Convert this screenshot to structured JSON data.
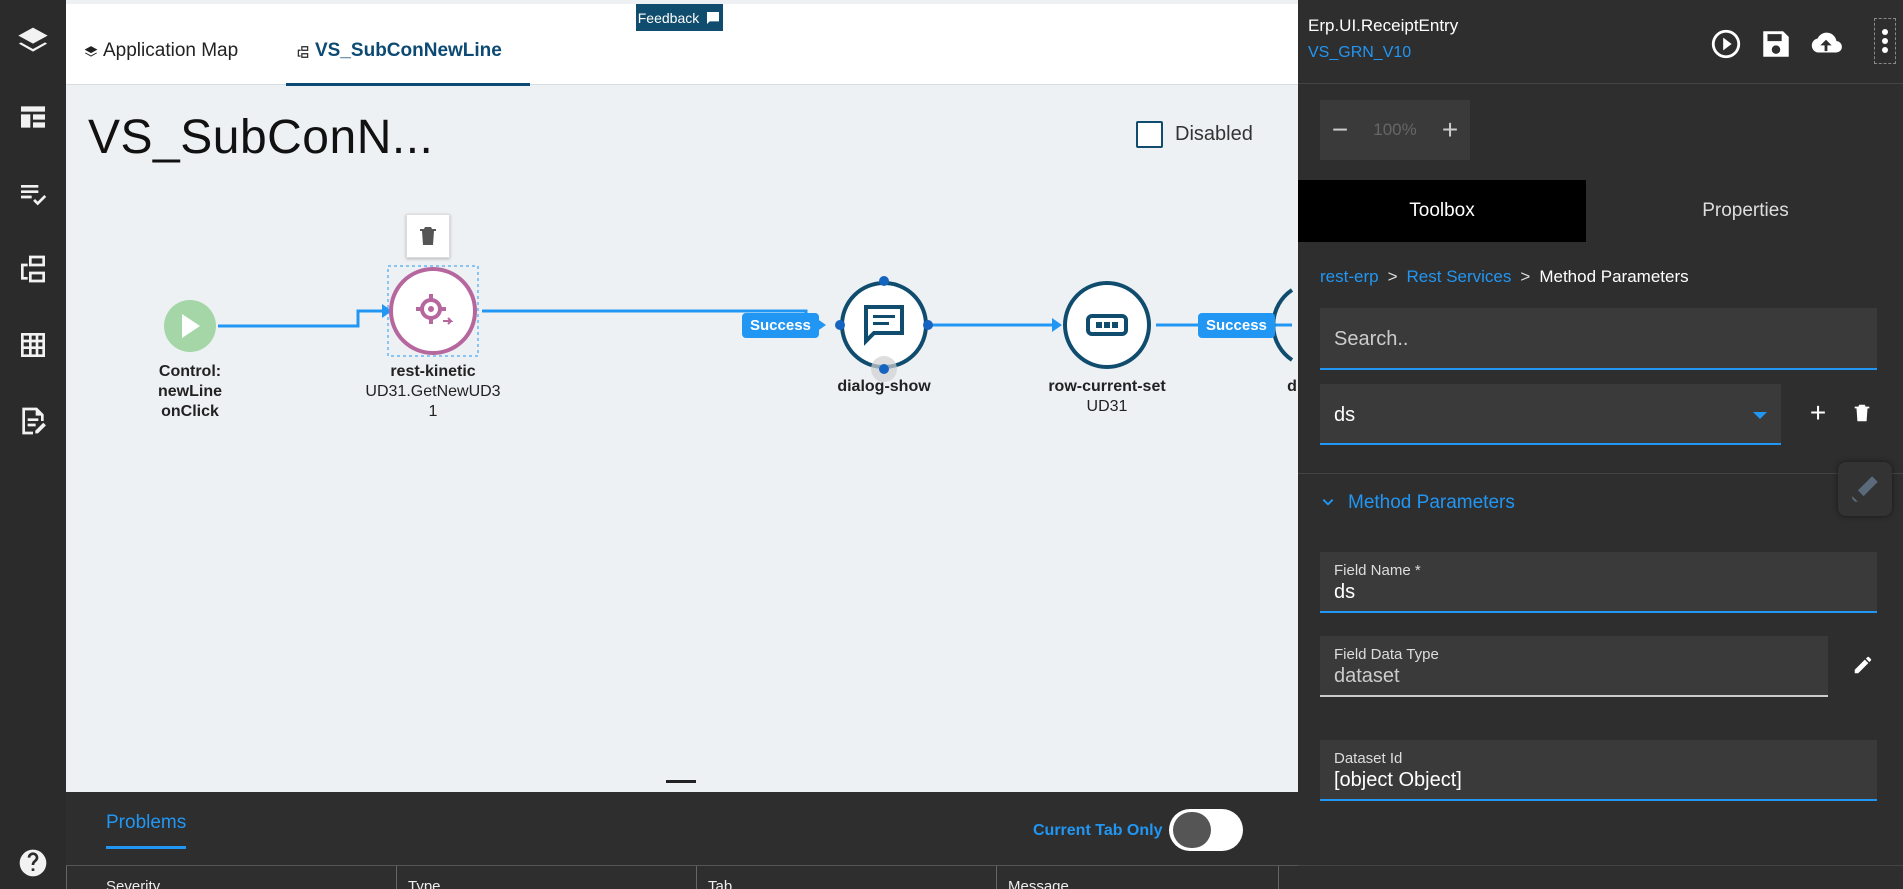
{
  "rail": {
    "icons": [
      "layers-icon",
      "layout-icon",
      "checklist-icon",
      "flow-icon",
      "grid-icon",
      "document-edit-icon",
      "help-icon"
    ]
  },
  "tabs": [
    {
      "label": "Application Map",
      "icon": "layers-icon"
    },
    {
      "label": "VS_SubConNewLine",
      "icon": "flow-icon"
    }
  ],
  "feedback": {
    "label": "Feedback"
  },
  "page": {
    "title": "VS_SubConN...",
    "disabled_label": "Disabled"
  },
  "flow": {
    "nodes": [
      {
        "label": "Control:",
        "label2": "newLine",
        "label3": "onClick"
      },
      {
        "label": "rest-kinetic",
        "label2": "UD31.GetNewUD3",
        "label3": "1"
      },
      {
        "label": "dialog-show"
      },
      {
        "label": "row-current-set",
        "label2": "UD31"
      },
      {
        "label": "d"
      }
    ],
    "badges": [
      "Success",
      "Success"
    ]
  },
  "bottom": {
    "problems_tab": "Problems",
    "current_tab_only": "Current Tab Only",
    "columns": [
      "Severity",
      "Type",
      "Tab",
      "Message"
    ]
  },
  "right": {
    "app_name": "Erp.UI.ReceiptEntry",
    "app_version": "VS_GRN_V10",
    "zoom_value": "100%",
    "zoom_minus": "−",
    "zoom_plus": "+",
    "tabs": {
      "toolbox": "Toolbox",
      "properties": "Properties"
    },
    "breadcrumb": {
      "c1": "rest-erp",
      "c2": "Rest Services",
      "c3": "Method Parameters",
      "sep": ">"
    },
    "search_placeholder": "Search..",
    "select_value": "ds",
    "add_label": "+",
    "section_title": "Method Parameters",
    "fields": {
      "field_name_label": "Field Name *",
      "field_name_value": "ds",
      "data_type_label": "Field Data Type",
      "data_type_value": "dataset",
      "dataset_id_label": "Dataset Id",
      "dataset_id_value": "[object Object]"
    }
  },
  "colors": {
    "accent": "#2196f3",
    "brand": "#0f4c6e",
    "start_node": "#a5d6a7",
    "rest_node": "#b5679e"
  }
}
